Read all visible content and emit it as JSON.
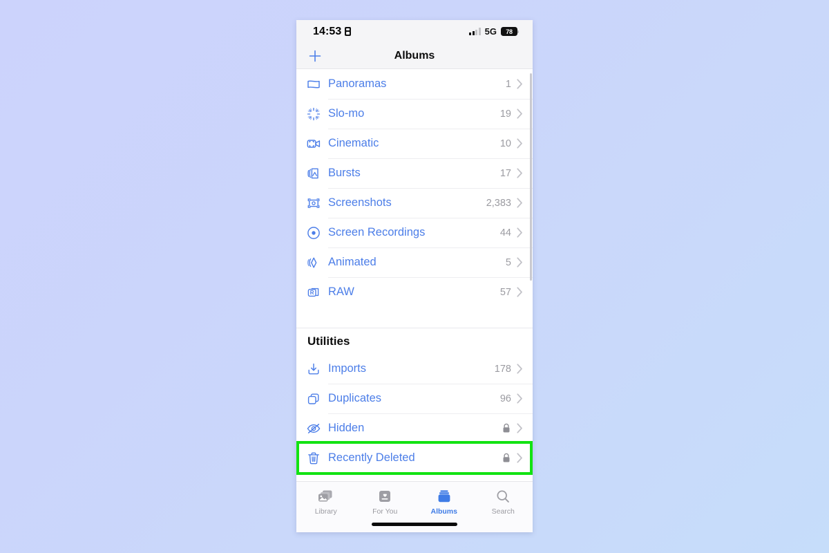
{
  "status_bar": {
    "time": "14:53",
    "recording_icon": "recording-indicator-icon",
    "signal_icon": "cellular-signal-icon",
    "network": "5G",
    "battery_percent": "78"
  },
  "nav_bar": {
    "add_icon": "plus-icon",
    "title": "Albums"
  },
  "media_types": {
    "rows": [
      {
        "icon": "panorama-icon",
        "label": "Panoramas",
        "count": "1"
      },
      {
        "icon": "slomo-icon",
        "label": "Slo-mo",
        "count": "19"
      },
      {
        "icon": "cinematic-icon",
        "label": "Cinematic",
        "count": "10"
      },
      {
        "icon": "bursts-icon",
        "label": "Bursts",
        "count": "17"
      },
      {
        "icon": "screenshots-icon",
        "label": "Screenshots",
        "count": "2,383"
      },
      {
        "icon": "screen-recordings-icon",
        "label": "Screen Recordings",
        "count": "44"
      },
      {
        "icon": "animated-icon",
        "label": "Animated",
        "count": "5"
      },
      {
        "icon": "raw-icon",
        "label": "RAW",
        "count": "57"
      }
    ]
  },
  "utilities": {
    "header": "Utilities",
    "rows": [
      {
        "icon": "imports-icon",
        "label": "Imports",
        "count": "178",
        "locked": false
      },
      {
        "icon": "duplicates-icon",
        "label": "Duplicates",
        "count": "96",
        "locked": false
      },
      {
        "icon": "hidden-icon",
        "label": "Hidden",
        "count": "",
        "locked": true
      },
      {
        "icon": "trash-icon",
        "label": "Recently Deleted",
        "count": "",
        "locked": true
      }
    ]
  },
  "highlight": {
    "target_label": "Recently Deleted",
    "color": "#12e312"
  },
  "tab_bar": {
    "tabs": [
      {
        "icon": "photos-library-icon",
        "label": "Library",
        "active": false
      },
      {
        "icon": "for-you-icon",
        "label": "For You",
        "active": false
      },
      {
        "icon": "albums-icon",
        "label": "Albums",
        "active": true
      },
      {
        "icon": "search-icon",
        "label": "Search",
        "active": false
      }
    ]
  },
  "colors": {
    "accent_blue": "#4c7ee8",
    "highlight_green": "#12e312",
    "background_top": "#ccd3fc",
    "background_bottom": "#c6ddfa"
  }
}
